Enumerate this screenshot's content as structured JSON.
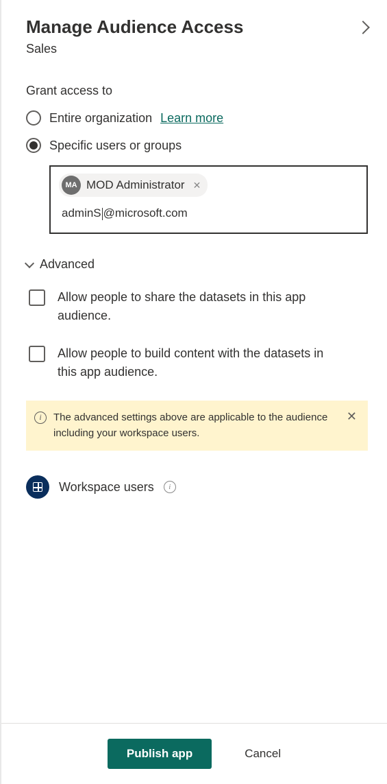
{
  "header": {
    "title": "Manage Audience Access",
    "subtitle": "Sales"
  },
  "grantAccess": {
    "label": "Grant access to",
    "option1": "Entire organization",
    "learnMore": "Learn more",
    "option2": "Specific users or groups"
  },
  "userPicker": {
    "chipInitials": "MA",
    "chipName": "MOD Administrator",
    "typedPrefix": "adminS",
    "typedSuffix": "@microsoft.com"
  },
  "advanced": {
    "label": "Advanced",
    "check1": "Allow people to share the datasets in this app audience.",
    "check2": "Allow people to build content with the datasets in this app audience."
  },
  "infoBar": {
    "text": "The advanced settings above are applicable to the audience including your workspace users."
  },
  "workspace": {
    "label": "Workspace users"
  },
  "footer": {
    "publish": "Publish app",
    "cancel": "Cancel"
  }
}
